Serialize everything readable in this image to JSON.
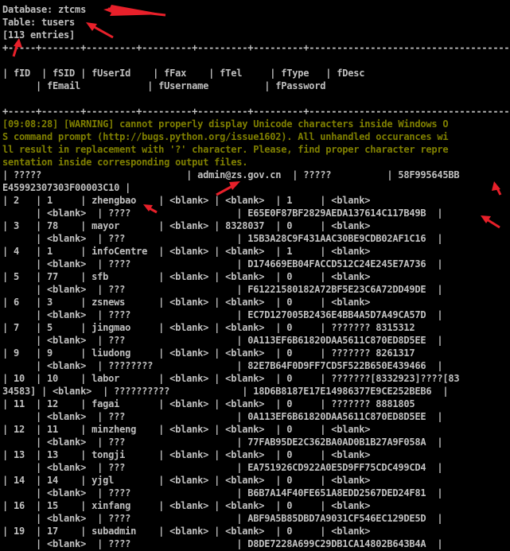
{
  "console": {
    "lines": [
      {
        "text": "Database: ztcms",
        "style": "normal"
      },
      {
        "text": "Table: tusers",
        "style": "normal"
      },
      {
        "text": "[113 entries]",
        "style": "normal"
      },
      {
        "text": "+-----+-------+---------+---------+---------+---------+----------------------------------------",
        "style": "normal"
      },
      {
        "text": "",
        "style": "normal"
      },
      {
        "text": "| fID  | fSID | fUserId    | fFax    | fTel     | fType   | fDesc",
        "style": "normal"
      },
      {
        "text": "      | fEmail            | fUsername          | fPassword",
        "style": "normal"
      },
      {
        "text": "",
        "style": "normal"
      },
      {
        "text": "+-----+-------+---------+---------+---------+---------+----------------------------------------",
        "style": "normal"
      },
      {
        "text": "[09:08:28] [WARNING] cannot properly display Unicode characters inside Windows O",
        "style": "warn"
      },
      {
        "text": "S command prompt (http://bugs.python.org/issue1602). All unhandled occurances wi",
        "style": "warn"
      },
      {
        "text": "ll result in replacement with '?' character. Please, find proper character repre",
        "style": "warn"
      },
      {
        "text": "sentation inside corresponding output files.",
        "style": "warn"
      },
      {
        "text": "| ?????                          | admin@zs.gov.cn  | ?????          | 58F995645BB",
        "style": "normal"
      },
      {
        "text": "E45992307303F00003C10 |",
        "style": "normal"
      },
      {
        "text": "| 2   | 1     | zhengbao    | <blank> | <blank>  | 1     | <blank>",
        "style": "normal"
      },
      {
        "text": "      | <blank>  | ????                   | E65E0F87BF2829AEDA137614C117B49B  |",
        "style": "normal"
      },
      {
        "text": "| 3   | 78    | mayor       | <blank> | 8328037  | 0     | <blank>",
        "style": "normal"
      },
      {
        "text": "      | <blank>  | ???                    | 15B3A28C9F431AAC30BE9CDB02AF1C16  |",
        "style": "normal"
      },
      {
        "text": "| 4   | 1     | infoCentre  | <blank> | <blank>  | 1     | <blank>",
        "style": "normal"
      },
      {
        "text": "      | <blank>  | ????                   | D174669EB04FACCD512C24E245E7A736  |",
        "style": "normal"
      },
      {
        "text": "| 5   | 77    | sfb         | <blank> | <blank>  | 0     | <blank>",
        "style": "normal"
      },
      {
        "text": "      | <blank>  | ???                    | F61221580182A72BF5E23C6A72DD49DE  |",
        "style": "normal"
      },
      {
        "text": "| 6   | 3     | zsnews      | <blank> | <blank>  | 0     | <blank>",
        "style": "normal"
      },
      {
        "text": "      | <blank>  | ????                   | EC7D127005B2436E4BB4A5D7A49CA57D  |",
        "style": "normal"
      },
      {
        "text": "| 7   | 5     | jingmao     | <blank> | <blank>  | 0     | ??????? 8315312",
        "style": "normal"
      },
      {
        "text": "      | <blank>  | ???                    | 0A113EF6B61820DAA5611C870ED8D5EE  |",
        "style": "normal"
      },
      {
        "text": "| 9   | 9     | liudong     | <blank> | <blank>  | 0     | ??????? 8261317",
        "style": "normal"
      },
      {
        "text": "      | <blank>  | ????????               | 82E7B64F0D9FF7CD5F522B650E439466  |",
        "style": "normal"
      },
      {
        "text": "| 10  | 10    | labor       | <blank> | <blank>  | 0     | ???????[8332923]????[83",
        "style": "normal"
      },
      {
        "text": "34583] | <blank>  | ??????????             | 18D6B8187E17E14986377E9CE252BEB6  |",
        "style": "normal"
      },
      {
        "text": "| 11  | 12    | fagai       | <blank> | <blank>  | 0     | ??????? 8881805",
        "style": "normal"
      },
      {
        "text": "      | <blank>  | ???                    | 0A113EF6B61820DAA5611C870ED8D5EE  |",
        "style": "normal"
      },
      {
        "text": "| 12  | 11    | minzheng    | <blank> | <blank>  | 0     | <blank>",
        "style": "normal"
      },
      {
        "text": "      | <blank>  | ???                    | 77FAB95DE2C362BA0AD0B1B27A9F058A  |",
        "style": "normal"
      },
      {
        "text": "| 13  | 13    | tongji      | <blank> | <blank>  | 0     | <blank>",
        "style": "normal"
      },
      {
        "text": "      | <blank>  | ???                    | EA751926CD922A0E5D9FF75CDC499CD4  |",
        "style": "normal"
      },
      {
        "text": "| 14  | 14    | yjgl        | <blank> | <blank>  | 0     | <blank>",
        "style": "normal"
      },
      {
        "text": "      | <blank>  | ????                   | B6B7A14F40FE651A8EDD2567DED24F81  |",
        "style": "normal"
      },
      {
        "text": "| 16  | 15    | xinfang     | <blank> | <blank>  | 0     | <blank>",
        "style": "normal"
      },
      {
        "text": "      | <blank>  | ????                   | ABF9A5B85DBD7A9031CF546EC129DE5D  |",
        "style": "normal"
      },
      {
        "text": "| 19  | 17    | subadmin    | <blank> | <blank>  | 0     | <blank>",
        "style": "normal"
      },
      {
        "text": "      | <blank>  | ????                   | D8DE7228A699C29DB1CA14802B643B4A  |",
        "style": "normal"
      }
    ]
  },
  "colors": {
    "background": "#000000",
    "text": "#c0c0c0",
    "warning": "#808000",
    "annotation_arrow": "#e8202a"
  }
}
